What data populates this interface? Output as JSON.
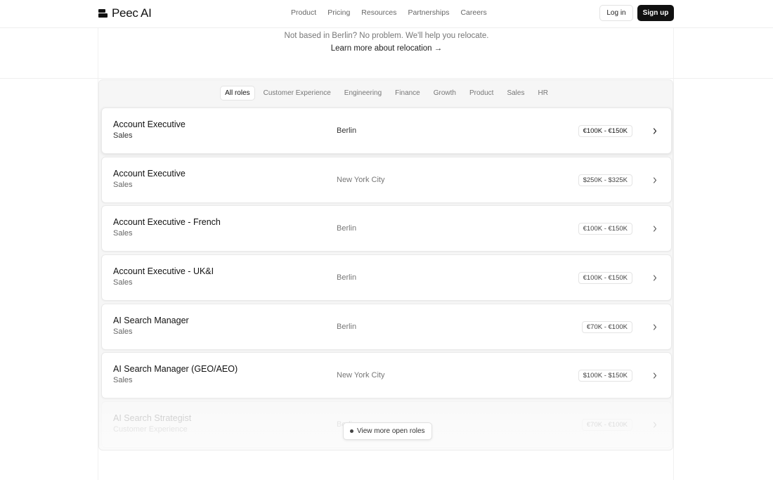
{
  "header": {
    "brand": "Peec AI",
    "nav": [
      "Product",
      "Pricing",
      "Resources",
      "Partnerships",
      "Careers"
    ],
    "login_label": "Log in",
    "signup_label": "Sign up"
  },
  "relocation": {
    "text": "Not based in Berlin? No problem. We'll help you relocate.",
    "link": "Learn more about relocation →"
  },
  "filters": {
    "active": "All roles",
    "items": [
      "All roles",
      "Customer Experience",
      "Engineering",
      "Finance",
      "Growth",
      "Product",
      "Sales",
      "HR"
    ]
  },
  "jobs": [
    {
      "title": "Account Executive",
      "dept": "Sales",
      "location": "Berlin",
      "salary": "€100K - €150K"
    },
    {
      "title": "Account Executive",
      "dept": "Sales",
      "location": "New York City",
      "salary": "$250K - $325K"
    },
    {
      "title": "Account Executive - French",
      "dept": "Sales",
      "location": "Berlin",
      "salary": "€100K - €150K"
    },
    {
      "title": "Account Executive - UK&I",
      "dept": "Sales",
      "location": "Berlin",
      "salary": "€100K - €150K"
    },
    {
      "title": "AI Search Manager",
      "dept": "Sales",
      "location": "Berlin",
      "salary": "€70K - €100K"
    },
    {
      "title": "AI Search Manager (GEO/AEO)",
      "dept": "Sales",
      "location": "New York City",
      "salary": "$100K - $150K"
    },
    {
      "title": "AI Search Strategist",
      "dept": "Customer Experience",
      "location": "Berlin",
      "salary": "€70K - €100K"
    }
  ],
  "view_more_label": "View more open roles"
}
